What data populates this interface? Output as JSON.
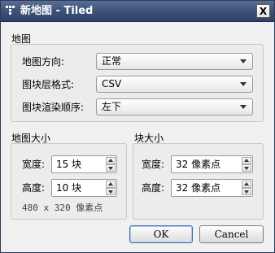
{
  "window": {
    "title": "新地图 - Tiled",
    "close_glyph": "X",
    "app_icon": "tiled-grid-icon"
  },
  "map": {
    "section_label": "地图",
    "orientation_label": "地图方向:",
    "orientation_value": "正常",
    "layer_format_label": "图块层格式:",
    "layer_format_value": "CSV",
    "render_order_label": "图块渲染顺序:",
    "render_order_value": "左下"
  },
  "map_size": {
    "section_label": "地图大小",
    "width_label": "宽度:",
    "width_value": "15 块",
    "height_label": "高度:",
    "height_value": "10 块",
    "pixel_size_note": "480 x 320 像素点"
  },
  "tile_size": {
    "section_label": "块大小",
    "width_label": "宽度:",
    "width_value": "32 像素点",
    "height_label": "高度:",
    "height_value": "32 像素点"
  },
  "buttons": {
    "ok": "OK",
    "cancel": "Cancel"
  }
}
